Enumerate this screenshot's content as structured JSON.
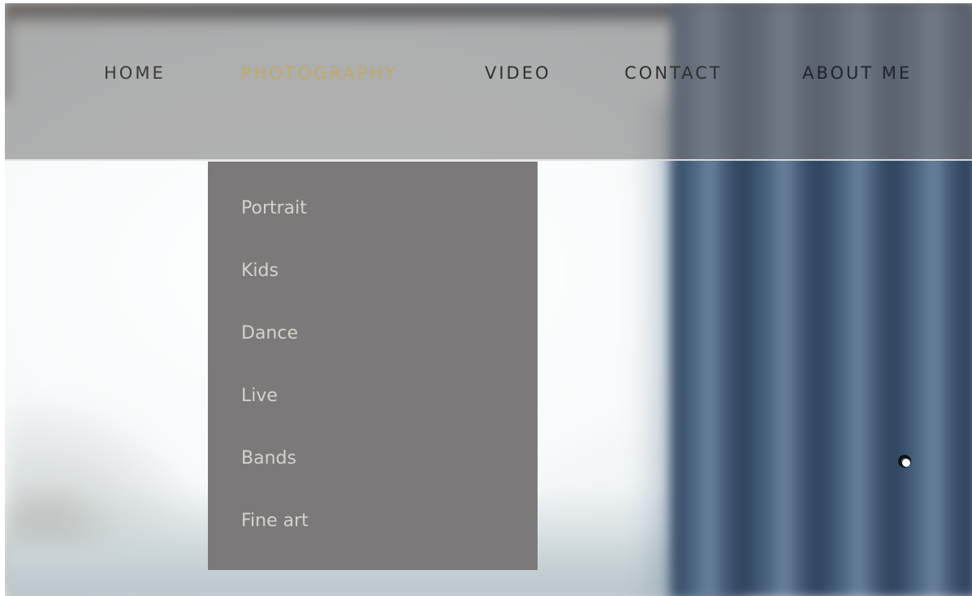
{
  "nav": {
    "items": [
      {
        "label": "HOME"
      },
      {
        "label": "PHOTOGRAPHY",
        "active": true
      },
      {
        "label": "VIDEO"
      },
      {
        "label": "CONTACT"
      },
      {
        "label": "ABOUT ME"
      }
    ]
  },
  "dropdown": {
    "items": [
      {
        "label": "Portrait"
      },
      {
        "label": "Kids"
      },
      {
        "label": "Dance"
      },
      {
        "label": "Live"
      },
      {
        "label": "Bands"
      },
      {
        "label": "Fine art"
      }
    ]
  },
  "colors": {
    "active_nav": "#c2a96a",
    "dropdown_bg": "#7b7979",
    "dropdown_text": "#d6d2cd",
    "nav_band": "#787878"
  },
  "icons": {
    "cursor": "cursor-ring-icon"
  }
}
